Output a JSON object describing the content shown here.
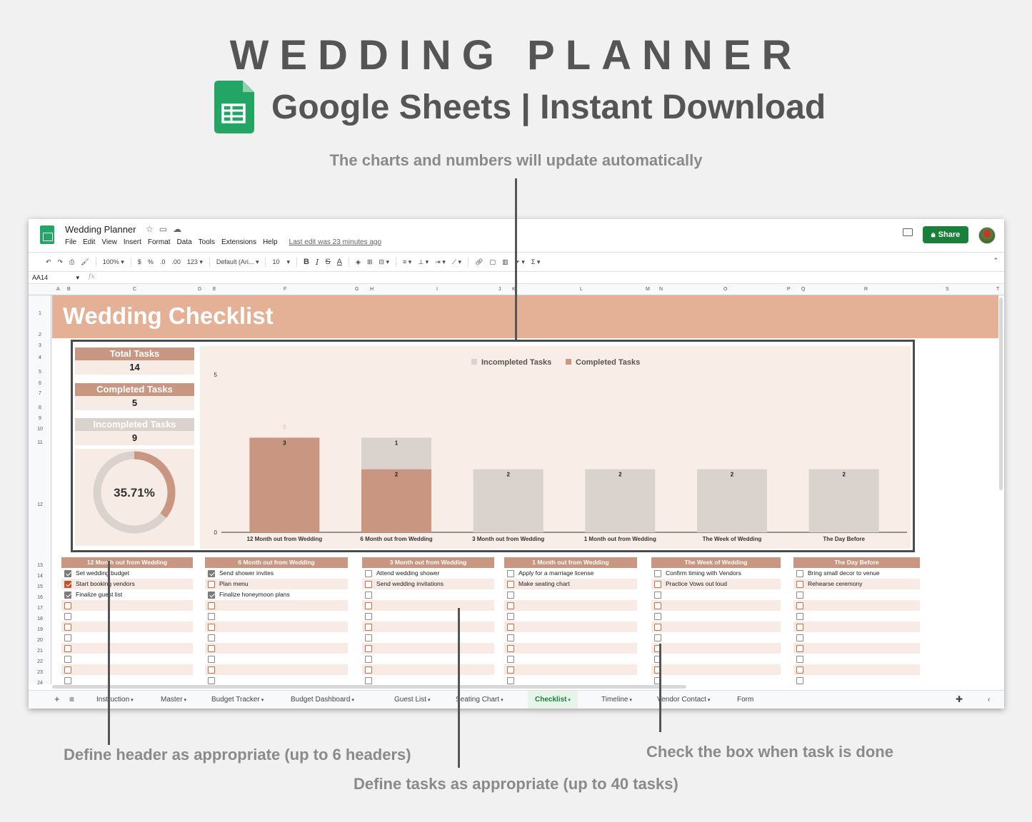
{
  "promo": {
    "title": "WEDDING PLANNER",
    "subtitle": "Google Sheets | Instant Download",
    "note": "The charts and numbers will update automatically",
    "callout_header": "Define header as appropriate (up to 6 headers)",
    "callout_tasks": "Define tasks as appropriate (up to 40 tasks)",
    "callout_check": "Check the box when task is done"
  },
  "app": {
    "doc_title": "Wedding Planner",
    "menu": [
      "File",
      "Edit",
      "View",
      "Insert",
      "Format",
      "Data",
      "Tools",
      "Extensions",
      "Help"
    ],
    "last_edit": "Last edit was 23 minutes ago",
    "share_label": "Share",
    "zoom": "100%",
    "currency": "$",
    "percent": "%",
    "dec_less": ".0",
    "dec_more": ".00",
    "more_formats": "123",
    "font": "Default (Ari...",
    "font_size": "10",
    "cell_ref": "AA14",
    "fx": "fx"
  },
  "columns": [
    "A",
    "B",
    "C",
    "D",
    "E",
    "F",
    "G",
    "H",
    "I",
    "J",
    "K",
    "L",
    "M",
    "N",
    "O",
    "P",
    "Q",
    "R",
    "S",
    "T"
  ],
  "rows": [
    "1",
    "2",
    "3",
    "4",
    "5",
    "6",
    "7",
    "8",
    "9",
    "10",
    "11",
    "12",
    "13",
    "14",
    "15",
    "16",
    "17",
    "18",
    "19",
    "20",
    "21",
    "22",
    "23",
    "24"
  ],
  "sheet": {
    "banner": "Wedding Checklist",
    "total_label": "Total Tasks",
    "total_value": "14",
    "completed_label": "Completed Tasks",
    "completed_value": "5",
    "incompleted_label": "Incompleted Tasks",
    "incompleted_value": "9",
    "percent_complete": "35.71%"
  },
  "chart_data": {
    "type": "bar",
    "stacked": true,
    "categories": [
      "12 Month out from Wedding",
      "6 Month out from Wedding",
      "3 Month out from Wedding",
      "1 Month out from Wedding",
      "The Week of Wedding",
      "The Day Before"
    ],
    "series": [
      {
        "name": "Completed Tasks",
        "values": [
          3,
          2,
          0,
          0,
          0,
          0
        ],
        "color": "#c99682"
      },
      {
        "name": "Incompleted Tasks",
        "values": [
          0,
          1,
          2,
          2,
          2,
          2
        ],
        "color": "#d9d2cd"
      }
    ],
    "y_ticks": [
      "0",
      "5"
    ],
    "ylim": [
      0,
      5
    ],
    "legend": "top"
  },
  "donut": {
    "value": 35.71,
    "label": "35.71%",
    "fill": "#c99682",
    "track": "#d9d2cd"
  },
  "tasklists": [
    {
      "header": "12 Month out from Wedding",
      "tasks": [
        {
          "text": "Set wedding budget",
          "checked": true
        },
        {
          "text": "Start booking vendors",
          "checked": true
        },
        {
          "text": "Finalize guest list",
          "checked": true
        }
      ]
    },
    {
      "header": "6 Month out from Wedding",
      "tasks": [
        {
          "text": "Send shower invites",
          "checked": true
        },
        {
          "text": "Plan menu",
          "checked": false
        },
        {
          "text": "Finalize honeymoon plans",
          "checked": true
        }
      ]
    },
    {
      "header": "3 Month out from Wedding",
      "tasks": [
        {
          "text": "Attend wedding shower",
          "checked": false
        },
        {
          "text": "Send wedding invitations",
          "checked": false
        }
      ]
    },
    {
      "header": "1 Month out from Wedding",
      "tasks": [
        {
          "text": "Apply for a marriage license",
          "checked": false
        },
        {
          "text": "Make seating chart",
          "checked": false
        }
      ]
    },
    {
      "header": "The Week of Wedding",
      "tasks": [
        {
          "text": "Confirm timing with Vendors",
          "checked": false
        },
        {
          "text": "Practice Vows out loud",
          "checked": false
        }
      ]
    },
    {
      "header": "The Day Before",
      "tasks": [
        {
          "text": "Bring small decor to venue",
          "checked": false
        },
        {
          "text": "Rehearse ceremony",
          "checked": false
        }
      ]
    }
  ],
  "tabs": {
    "add": "+",
    "all": "≡",
    "items": [
      "Instruction",
      "Master",
      "Budget Tracker",
      "Budget Dashboard",
      "Guest List",
      "Seating Chart",
      "Checklist",
      "Timeline",
      "Vendor Contact",
      "Form"
    ],
    "active": "Checklist"
  }
}
